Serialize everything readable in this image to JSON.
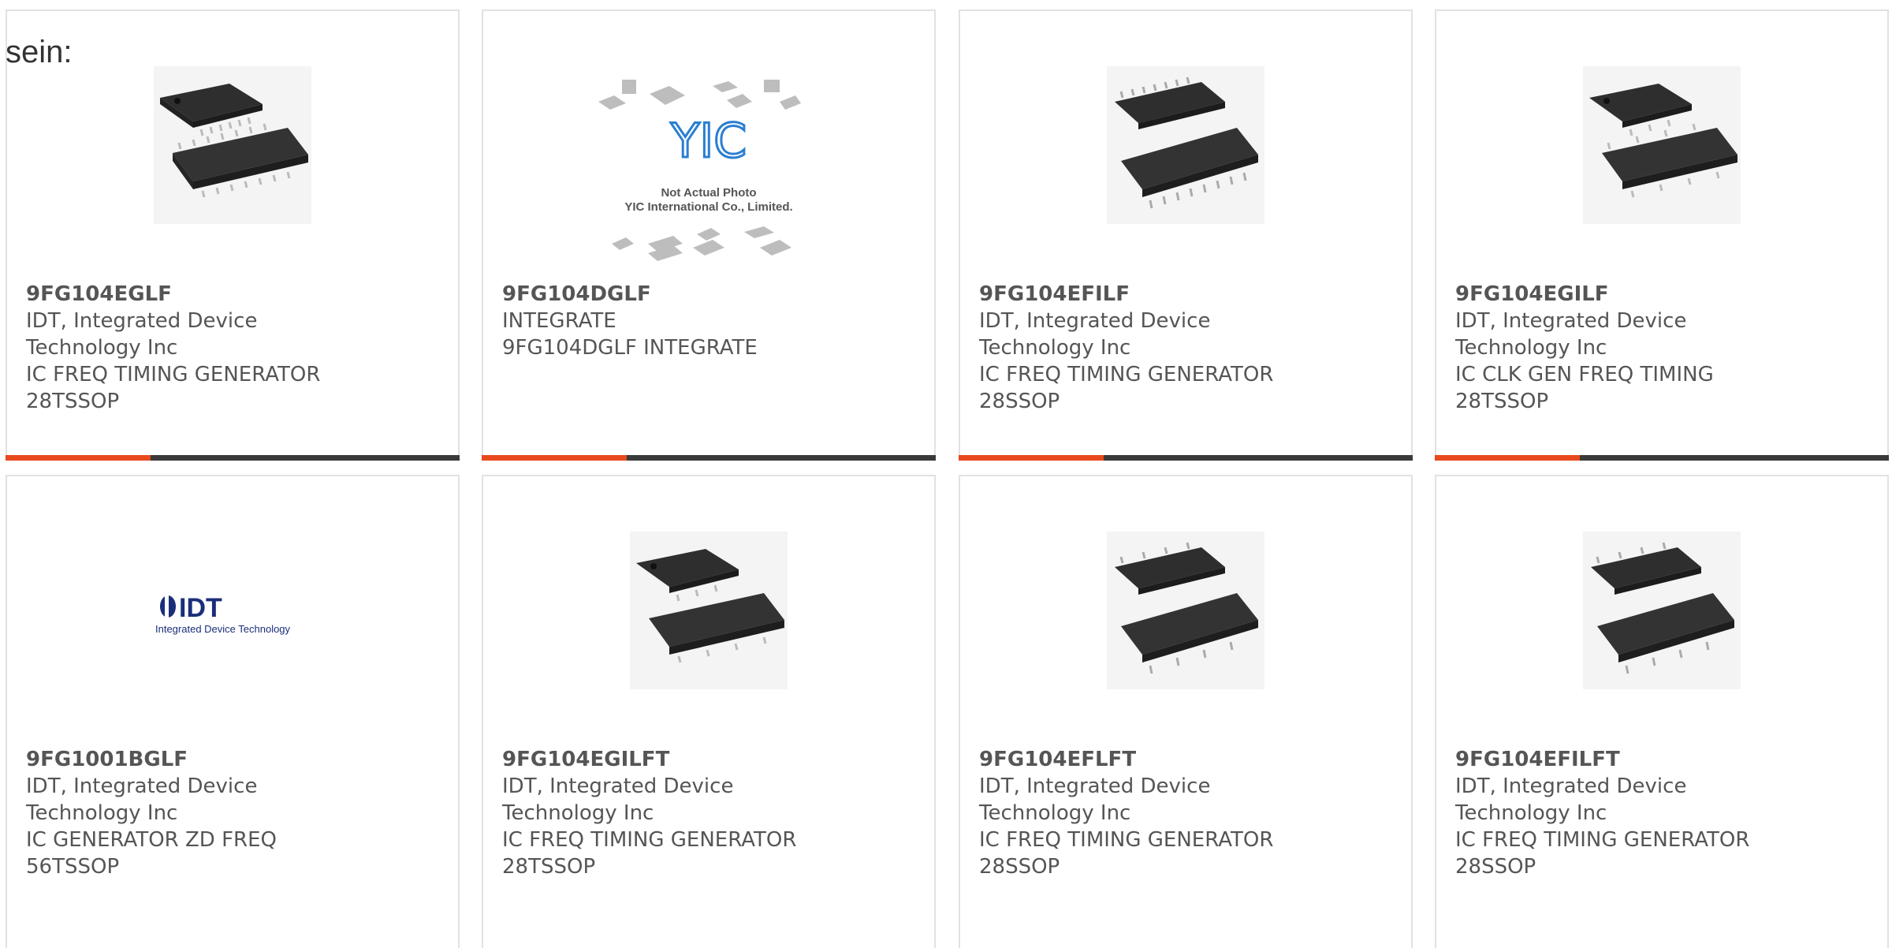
{
  "lead_text": "sein:",
  "products": [
    {
      "part": "9FG104EGLF",
      "mfr": "IDT, Integrated Device Technology Inc",
      "desc": "IC FREQ TIMING GENERATOR 28TSSOP",
      "image": "tssop-chip"
    },
    {
      "part": "9FG104DGLF",
      "mfr": "INTEGRATE",
      "desc": "9FG104DGLF INTEGRATE",
      "image": "yic-placeholder",
      "image_text": {
        "logo": "YIC",
        "line1": "Not Actual Photo",
        "line2": "YIC International Co., Limited."
      }
    },
    {
      "part": "9FG104EFILF",
      "mfr": "IDT, Integrated Device Technology Inc",
      "desc": "IC FREQ TIMING GENERATOR 28SSOP",
      "image": "ssop-chip"
    },
    {
      "part": "9FG104EGILF",
      "mfr": "IDT, Integrated Device Technology Inc",
      "desc": "IC CLK GEN FREQ TIMING 28TSSOP",
      "image": "tssop-chip"
    },
    {
      "part": "9FG1001BGLF",
      "mfr": "IDT, Integrated Device Technology Inc",
      "desc": "IC GENERATOR ZD FREQ 56TSSOP",
      "image": "idt-logo",
      "image_text": {
        "logo": "IDT",
        "tagline": "Integrated Device Technology"
      }
    },
    {
      "part": "9FG104EGILFT",
      "mfr": "IDT, Integrated Device Technology Inc",
      "desc": "IC FREQ TIMING GENERATOR 28TSSOP",
      "image": "tssop-chip"
    },
    {
      "part": "9FG104EFLFT",
      "mfr": "IDT, Integrated Device Technology Inc",
      "desc": "IC FREQ TIMING GENERATOR 28SSOP",
      "image": "ssop-chip"
    },
    {
      "part": "9FG104EFILFT",
      "mfr": "IDT, Integrated Device Technology Inc",
      "desc": "IC FREQ TIMING GENERATOR 28SSOP",
      "image": "ssop-chip"
    }
  ],
  "colors": {
    "accent": "#e8491d",
    "bar": "#3a3a3a",
    "border": "#e2e2e2",
    "text": "#555555"
  }
}
